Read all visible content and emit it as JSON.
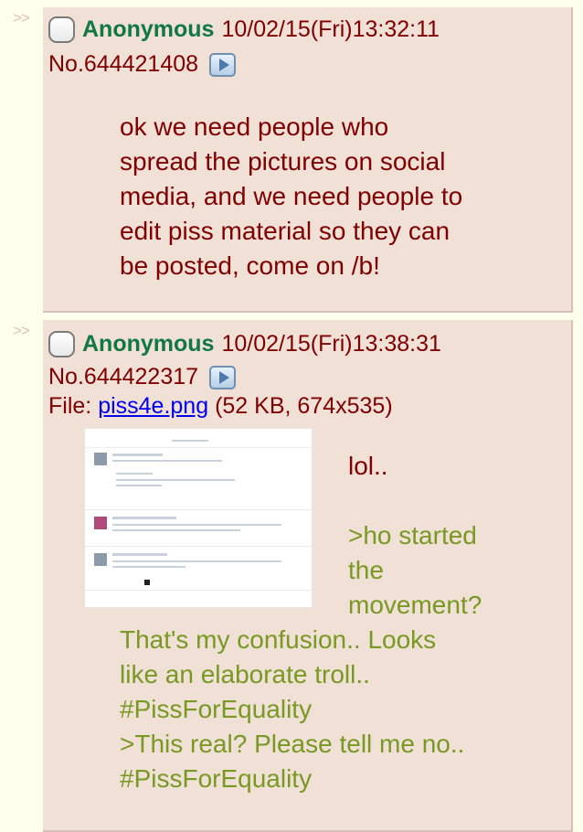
{
  "posts": [
    {
      "arrows": ">>",
      "name": "Anonymous",
      "datetime": "10/02/15(Fri)13:32:11",
      "number": "No.644421408",
      "message": [
        "ok we need people who",
        "spread the pictures on social",
        "media, and we need people to",
        "edit piss material so they can",
        "be posted, come on /b!"
      ]
    },
    {
      "arrows": ">>",
      "name": "Anonymous",
      "datetime": "10/02/15(Fri)13:38:31",
      "number": "No.644422317",
      "file_label": "File: ",
      "file_name": "piss4e.png",
      "file_meta": " (52 KB, 674x535)",
      "message_right": {
        "line1": "lol..",
        "quote": [
          ">ho started",
          "the",
          "movement?"
        ]
      },
      "message_below": [
        "That's my confusion.. Looks",
        "like an elaborate troll..",
        "#PissForEquality",
        ">This real? Please tell me no..",
        "#PissForEquality"
      ]
    }
  ],
  "icons": {
    "checkbox": "checkbox-icon",
    "play": "play-icon",
    "thumbnail": "image-thumbnail"
  },
  "colors": {
    "background": "#ffffee",
    "post_bg": "#f0e0d6",
    "name": "#117743",
    "text": "#800000",
    "greentext": "#789922",
    "link": "#0000ee"
  }
}
